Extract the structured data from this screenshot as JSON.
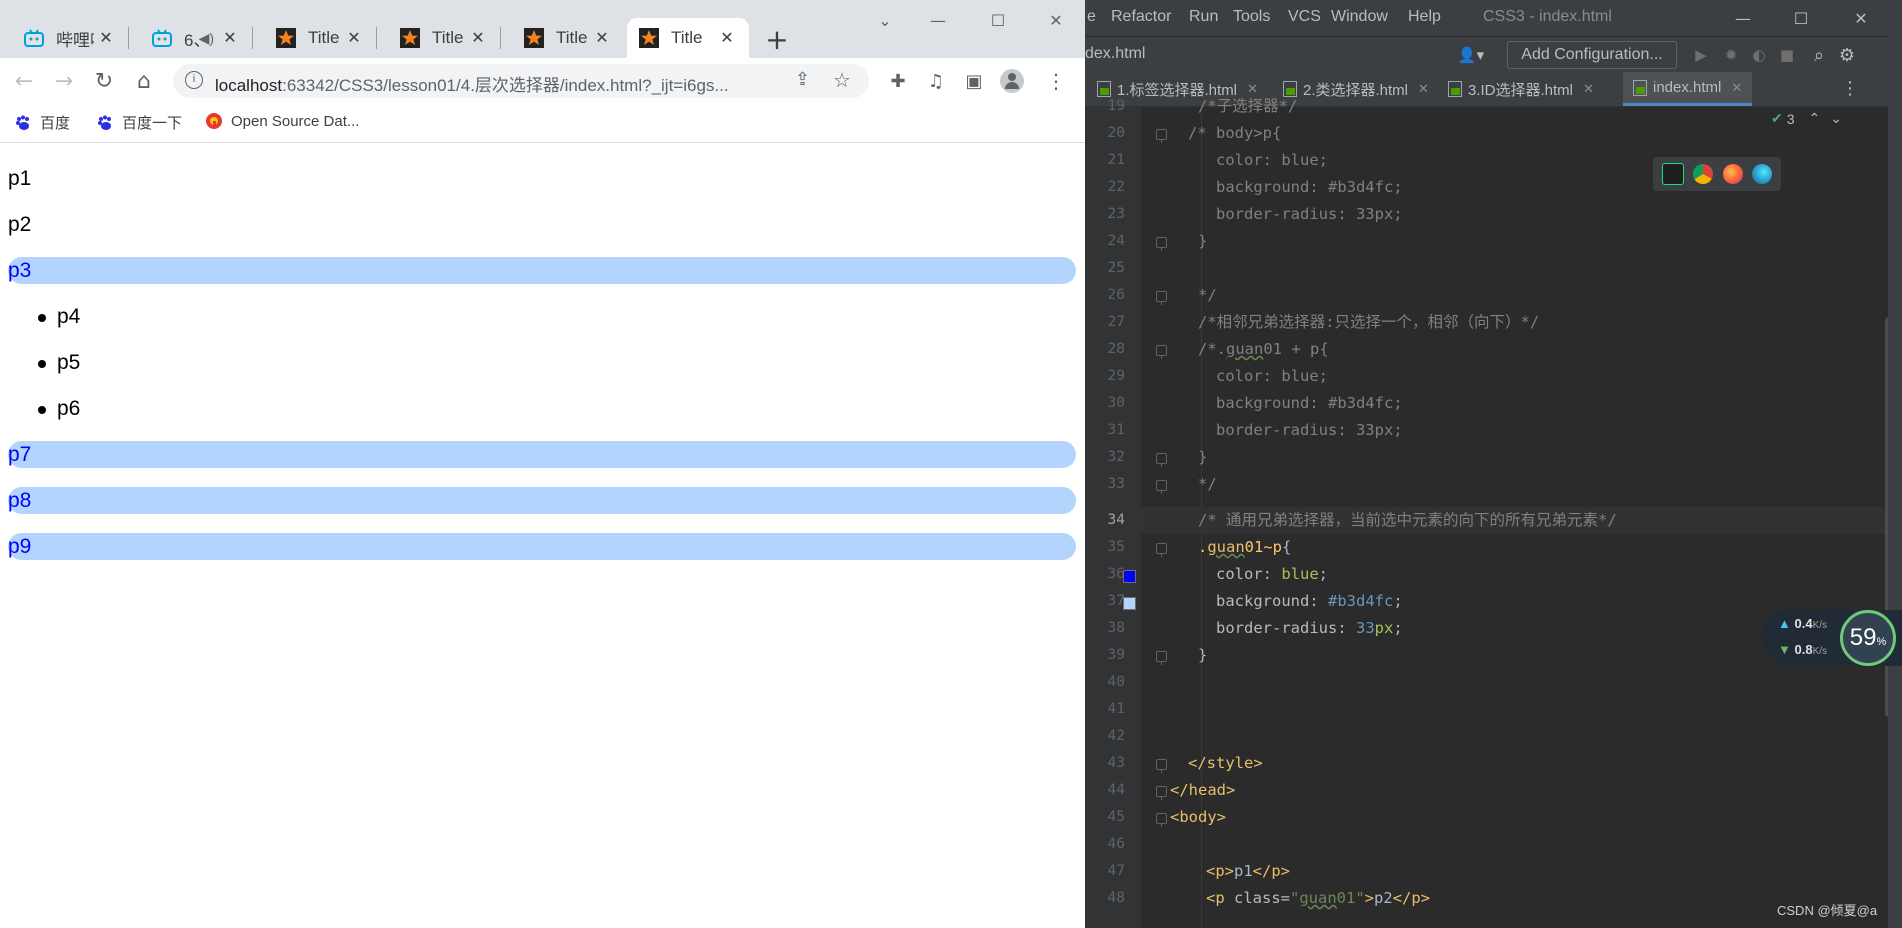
{
  "browser": {
    "tabs": [
      {
        "label": "哔哩哔",
        "icon": "bilibili-icon",
        "active": false
      },
      {
        "label": "6、",
        "icon": "bilibili-icon",
        "active": false,
        "audio": true
      },
      {
        "label": "Title",
        "icon": "webstorm-icon",
        "active": false
      },
      {
        "label": "Title",
        "icon": "webstorm-icon",
        "active": false
      },
      {
        "label": "Title",
        "icon": "webstorm-icon",
        "active": false
      },
      {
        "label": "Title",
        "icon": "webstorm-icon",
        "active": true
      }
    ],
    "new_tab": "+",
    "url": {
      "host": "localhost",
      "path": ":63342/CSS3/lesson01/4.层次选择器/index.html?_ijt=i6gs..."
    },
    "bookmarks": [
      {
        "label": "百度",
        "icon": "baidu-icon"
      },
      {
        "label": "百度一下",
        "icon": "baidu-icon"
      },
      {
        "label": "Open Source Dat...",
        "icon": "opensource-icon"
      }
    ]
  },
  "page": {
    "paragraphs": [
      {
        "text": "p1",
        "highlighted": false
      },
      {
        "text": "p2",
        "highlighted": false
      },
      {
        "text": "p3",
        "highlighted": true
      }
    ],
    "list_items": [
      "p4",
      "p5",
      "p6"
    ],
    "after_paragraphs": [
      {
        "text": "p7",
        "highlighted": true
      },
      {
        "text": "p8",
        "highlighted": true
      },
      {
        "text": "p9",
        "highlighted": true
      }
    ],
    "highlight_color": "#b3d4fc",
    "highlight_text_color": "blue"
  },
  "ide": {
    "menus": [
      "e",
      "Refactor",
      "Run",
      "Tools",
      "VCS",
      "Window",
      "Help"
    ],
    "title": "CSS3 - index.html",
    "breadcrumb": "dex.html",
    "add_configuration": "Add Configuration...",
    "tabs": [
      {
        "label": "1.标签选择器.html",
        "active": false
      },
      {
        "label": "2.类选择器.html",
        "active": false
      },
      {
        "label": "3.ID选择器.html",
        "active": false
      },
      {
        "label": "index.html",
        "active": true
      }
    ],
    "inspection_count": "3",
    "current_line": "34",
    "line_numbers": [
      "19",
      "20",
      "21",
      "22",
      "23",
      "24",
      "25",
      "26",
      "27",
      "28",
      "29",
      "30",
      "31",
      "32",
      "33",
      "34",
      "35",
      "36",
      "37",
      "38",
      "39",
      "40",
      "41",
      "42",
      "43",
      "44",
      "45",
      "46",
      "47",
      "48"
    ]
  },
  "netmon": {
    "up": "0.4",
    "down": "0.8",
    "unit": "K/s",
    "cpu": "59",
    "cpu_unit": "%"
  },
  "watermark": "CSDN @倾夏@a"
}
